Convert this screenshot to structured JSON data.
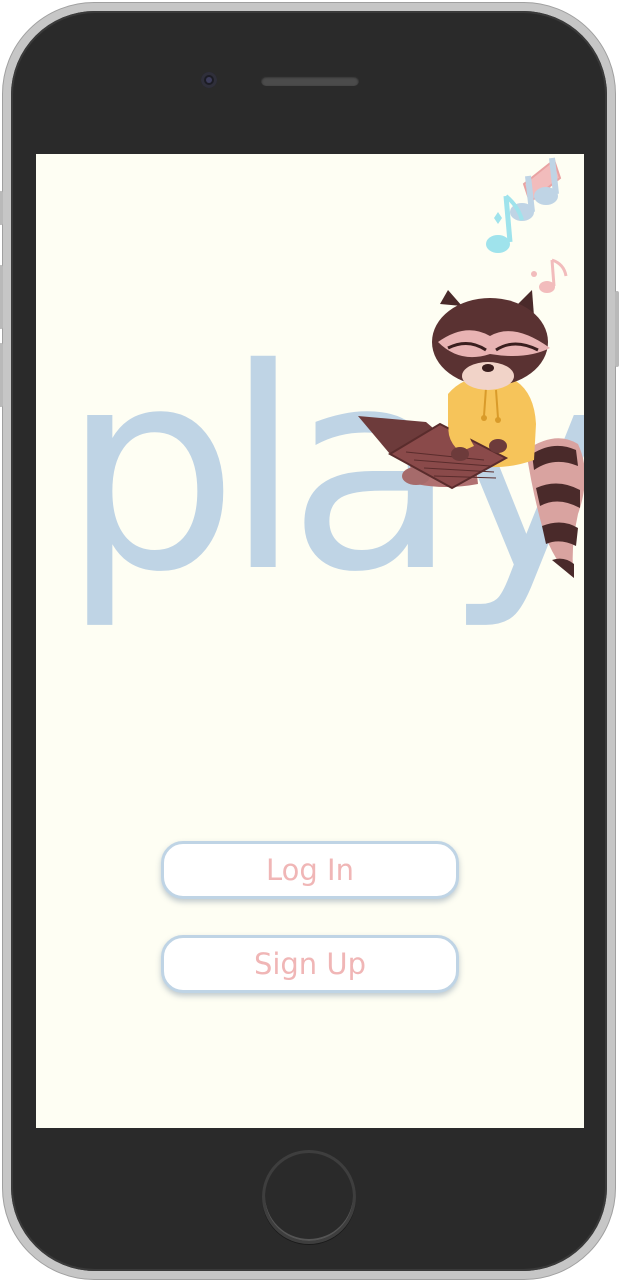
{
  "app": {
    "logo_text": "play!"
  },
  "buttons": {
    "login_label": "Log In",
    "signup_label": "Sign Up"
  },
  "colors": {
    "background": "#fefef3",
    "logo": "#bfd4e5",
    "button_border": "#bfd4e5",
    "button_text": "#f0b6b6",
    "device_frame": "#2a2a2a"
  },
  "icons": {
    "mascot": "raccoon-with-laptop-illustration",
    "music": "music-notes-icon"
  }
}
